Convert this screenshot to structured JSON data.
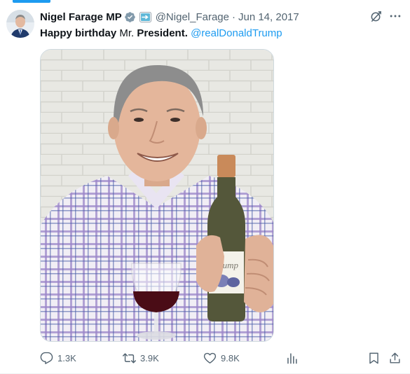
{
  "tweet": {
    "display_name": "Nigel Farage MP",
    "handle": "@Nigel_Farage",
    "separator": "·",
    "date": "Jun 14, 2017",
    "text": {
      "part1": "Happy birthday",
      "part2": " Mr. ",
      "part3": "President.",
      "mention": "@realDonaldTrump"
    },
    "media": {
      "bottle_label": "Trump"
    },
    "actions": {
      "replies": "1.3K",
      "reposts": "3.9K",
      "likes": "9.8K"
    }
  },
  "colors": {
    "accent": "#1d9bf0",
    "verified": "#829aab",
    "secondary_text": "#536471"
  },
  "icons": [
    "verified-badge-icon",
    "affiliate-badge-icon",
    "grok-icon",
    "more-icon",
    "reply-icon",
    "repost-icon",
    "like-icon",
    "views-icon",
    "bookmark-icon",
    "share-icon"
  ]
}
